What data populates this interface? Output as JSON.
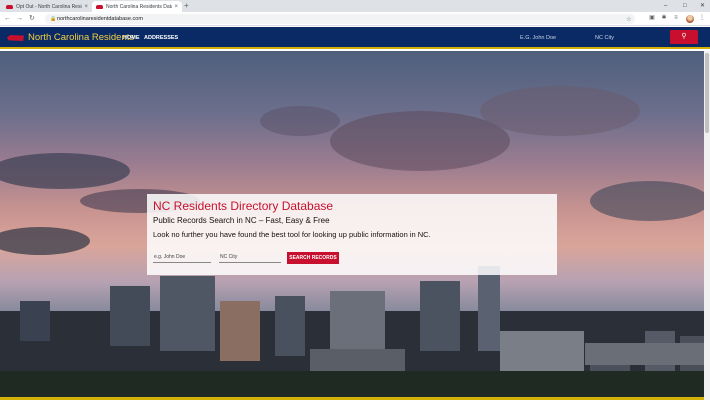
{
  "browser": {
    "tabs": [
      {
        "title": "Opt Out - North Carolina Reside"
      },
      {
        "title": "North Carolina Residents Datab"
      }
    ],
    "new_tab_glyph": "+",
    "close_glyph": "×",
    "url": "northcarolinaresidentdatabase.com"
  },
  "header": {
    "brand": "North Carolina Residents",
    "nav": [
      {
        "label": "HOME"
      },
      {
        "label": "ADDRESSES"
      }
    ],
    "name_placeholder": "E.G. John Doe",
    "city_placeholder": "NC City"
  },
  "card": {
    "title": "NC Residents Directory Database",
    "subtitle": "Public Records Search in NC – Fast, Easy & Free",
    "description": "Look no further you have found the best tool for looking up public information in NC.",
    "name_placeholder": "e.g. John Doe",
    "city_placeholder": "NC City",
    "button_label": "SEARCH RECORDS"
  },
  "colors": {
    "header_bg": "#0a2a66",
    "brand": "#f4d03f",
    "accent_red": "#c8102e",
    "gold": "#d4b106"
  }
}
